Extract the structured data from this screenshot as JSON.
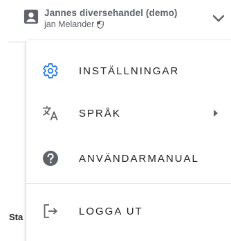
{
  "account": {
    "name": "Jannes diversehandel (demo)",
    "user": "jan Melander",
    "avatar_icon": "account-box-icon",
    "badge_icon": "shield-icon",
    "toggle_icon": "chevron-down-icon"
  },
  "background": {
    "partial_text": "Sta"
  },
  "menu": {
    "items": [
      {
        "label": "INSTÄLLNINGAR",
        "icon": "gear-icon",
        "icon_color": "#1a73e8"
      },
      {
        "label": "SPRÅK",
        "icon": "translate-icon",
        "has_submenu": true
      },
      {
        "label": "ANVÄNDARMANUAL",
        "icon": "help-circle-icon"
      },
      {
        "label": "LOGGA UT",
        "icon": "logout-icon"
      }
    ]
  },
  "colors": {
    "text": "#202124",
    "muted": "#5f6368",
    "accent": "#1a73e8",
    "divider": "#e0e0e0"
  }
}
